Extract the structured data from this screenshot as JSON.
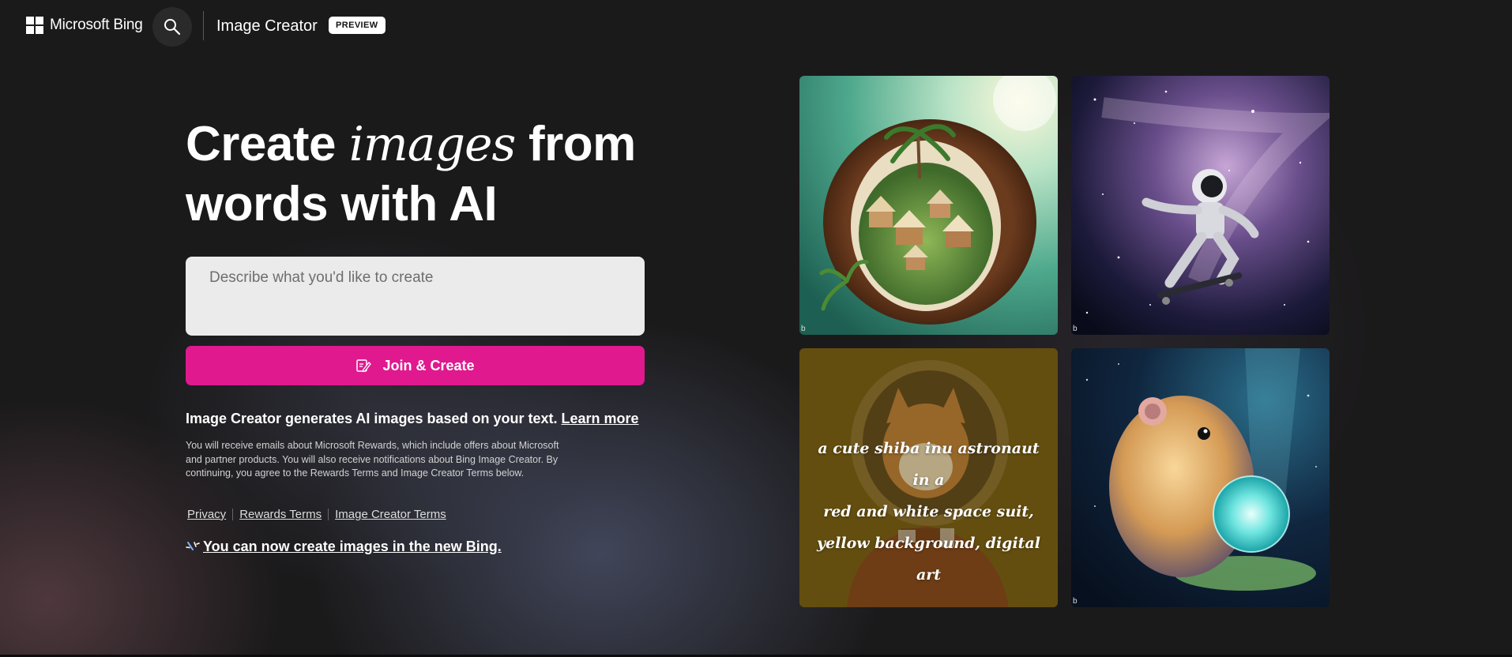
{
  "header": {
    "brand": "Microsoft Bing",
    "app_title": "Image Creator",
    "badge": "PREVIEW"
  },
  "hero": {
    "title_part1": "Create ",
    "title_emphasis": "images",
    "title_part2": " from words with AI"
  },
  "prompt": {
    "placeholder": "Describe what you'd like to create",
    "value": ""
  },
  "join_button": {
    "label": "Join & Create"
  },
  "info": {
    "text": "Image Creator generates AI images based on your text.",
    "learn_more": "Learn more"
  },
  "fine_print": "You will receive emails about Microsoft Rewards, which include offers about Microsoft and partner products. You will also receive notifications about Bing Image Creator. By continuing, you agree to the Rewards Terms and Image Creator Terms below.",
  "legal_links": {
    "privacy": "Privacy",
    "rewards_terms": "Rewards Terms",
    "image_creator_terms": "Image Creator Terms"
  },
  "new_bing_link": "You can now create images in the new Bing.",
  "gallery": {
    "tile_mark": "b",
    "caption_3_line1": "a cute shiba inu astronaut in a",
    "caption_3_line2": "red and white space suit,",
    "caption_3_line3": "yellow background, digital art"
  },
  "colors": {
    "background": "#1b1a1b",
    "accent": "#e0198f",
    "prompt_bg": "#ebebeb"
  }
}
